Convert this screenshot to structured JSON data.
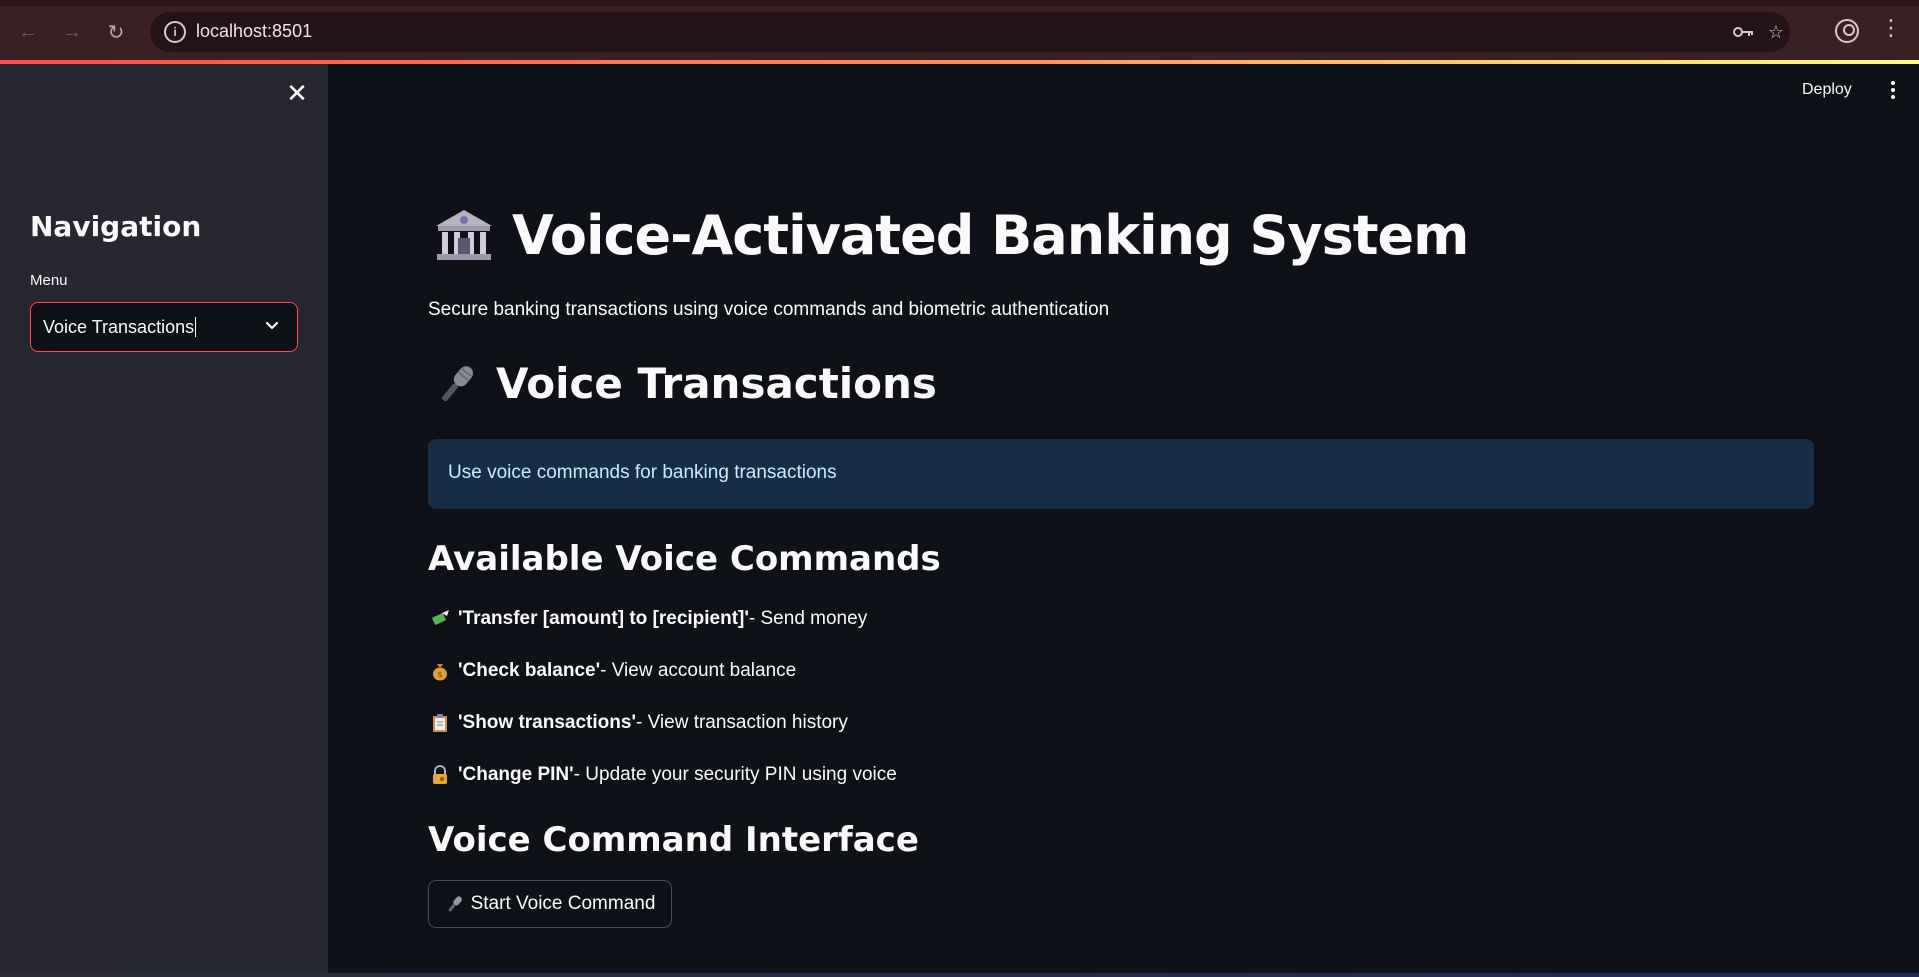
{
  "browser": {
    "url": "localhost:8501"
  },
  "sidebar": {
    "title": "Navigation",
    "menu_label": "Menu",
    "selected_option": "Voice Transactions"
  },
  "header": {
    "deploy_label": "Deploy"
  },
  "main": {
    "title": "Voice-Activated Banking System",
    "subtitle": "Secure banking transactions using voice commands and biometric authentication",
    "section_title": "Voice Transactions",
    "info_message": "Use voice commands for banking transactions",
    "commands_heading": "Available Voice Commands",
    "commands": [
      {
        "icon": "money-with-wings-icon",
        "command": "'Transfer [amount] to [recipient]'",
        "description": " - Send money"
      },
      {
        "icon": "money-bag-icon",
        "command": "'Check balance'",
        "description": " - View account balance"
      },
      {
        "icon": "clipboard-icon",
        "command": "'Show transactions'",
        "description": " - View transaction history"
      },
      {
        "icon": "locked-with-key-icon",
        "command": "'Change PIN'",
        "description": " - Update your security PIN using voice"
      }
    ],
    "interface_heading": "Voice Command Interface",
    "start_button_label": "Start Voice Command"
  },
  "colors": {
    "accent": "#ff4b4b",
    "background": "#0e1117",
    "sidebar": "#262730",
    "info_bg": "#172d43",
    "info_text": "#c7ebff"
  }
}
